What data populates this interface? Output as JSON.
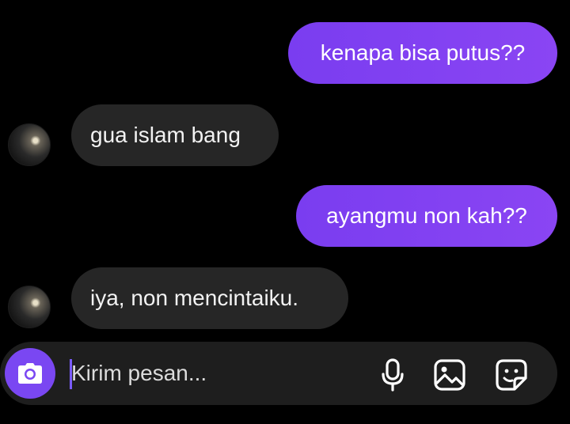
{
  "messages": [
    {
      "sender": "me",
      "text": "kenapa bisa putus??"
    },
    {
      "sender": "other",
      "text": "gua islam bang"
    },
    {
      "sender": "me",
      "text": "ayangmu non kah??"
    },
    {
      "sender": "other",
      "text": "iya, non mencintaiku."
    }
  ],
  "composer": {
    "placeholder": "Kirim pesan...",
    "icons": {
      "camera": "camera-icon",
      "mic": "microphone-icon",
      "gallery": "image-icon",
      "sticker": "sticker-icon"
    }
  },
  "colors": {
    "background": "#000000",
    "sent_bubble": "#7a3df0",
    "received_bubble": "#262626",
    "accent": "#7a47f2",
    "composer_bg": "#1e1e1e"
  }
}
